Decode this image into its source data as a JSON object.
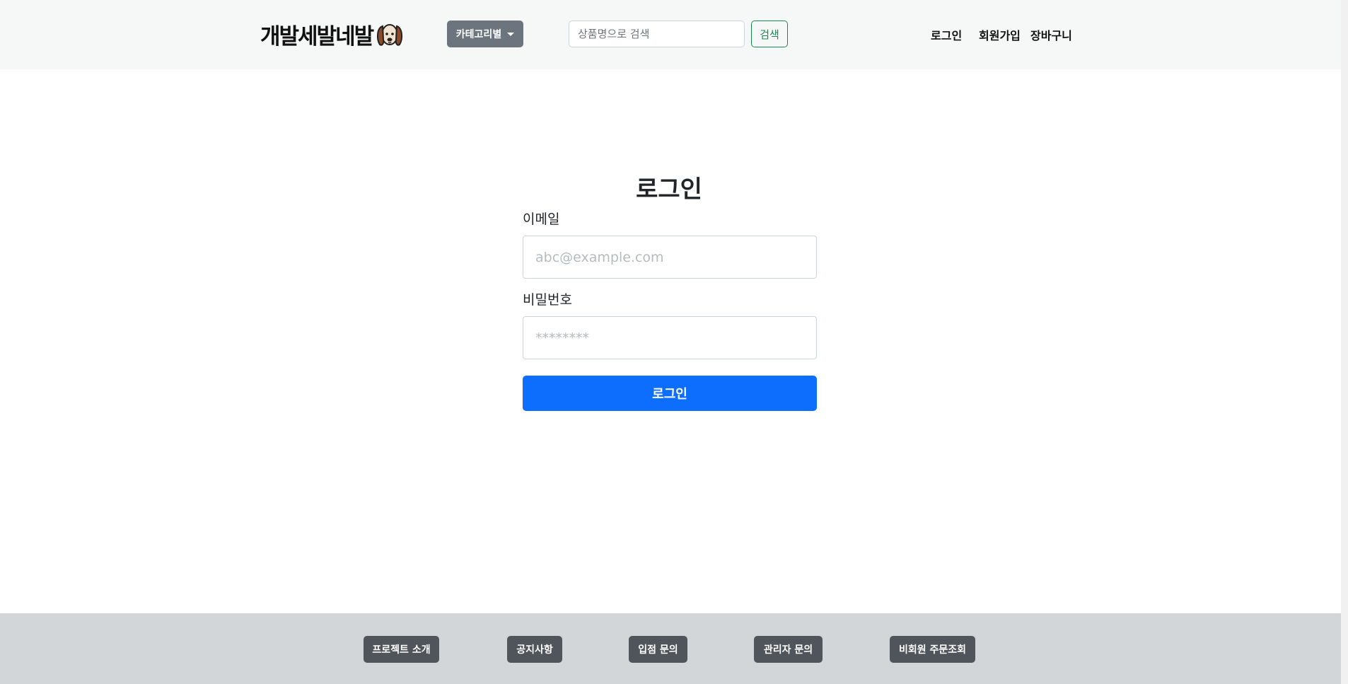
{
  "header": {
    "logo_text": "개발세발네발",
    "category_button": "카테고리별",
    "search": {
      "placeholder": "상품명으로 검색",
      "value": "",
      "button": "검색"
    },
    "nav": {
      "login": "로그인",
      "signup": "회원가입",
      "cart": "장바구니"
    }
  },
  "login": {
    "title": "로그인",
    "email_label": "이메일",
    "email_placeholder": "abc@example.com",
    "password_label": "비밀번호",
    "password_placeholder": "********",
    "submit": "로그인"
  },
  "footer": {
    "buttons": [
      "프로젝트 소개",
      "공지사항",
      "입점 문의",
      "관리자 문의",
      "비회원 주문조회"
    ]
  },
  "colors": {
    "primary": "#0d6efd",
    "success": "#198754",
    "secondary": "#6c757d",
    "footer_button": "#4f555a",
    "header_bg": "#f6f8f7",
    "footer_bg": "#d3d6d9"
  },
  "icons": {
    "logo_mascot": "dog-face-icon",
    "dropdown": "caret-down-icon"
  }
}
